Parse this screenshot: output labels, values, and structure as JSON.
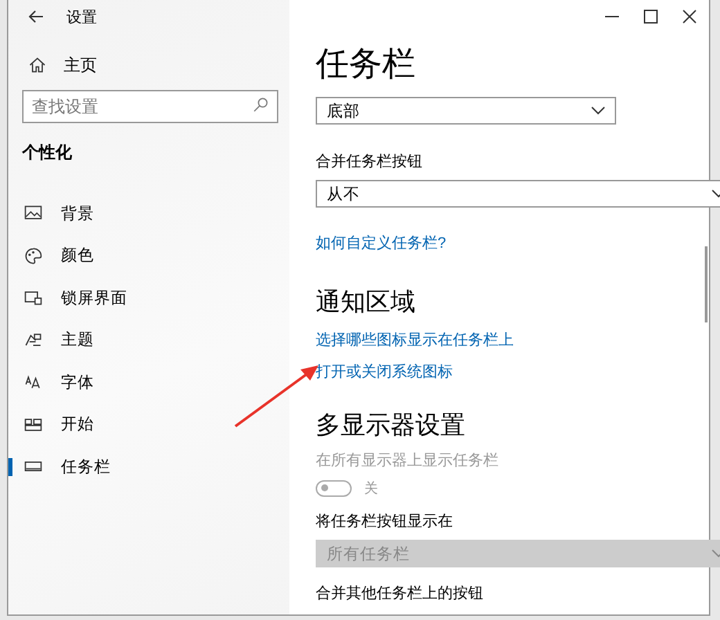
{
  "window": {
    "title": "设置"
  },
  "sidebar": {
    "home": "主页",
    "search": {
      "placeholder": "查找设置"
    },
    "section": "个性化",
    "items": [
      {
        "label": "背景",
        "selected": false
      },
      {
        "label": "颜色",
        "selected": false
      },
      {
        "label": "锁屏界面",
        "selected": false
      },
      {
        "label": "主题",
        "selected": false
      },
      {
        "label": "字体",
        "selected": false
      },
      {
        "label": "开始",
        "selected": false
      },
      {
        "label": "任务栏",
        "selected": true
      }
    ]
  },
  "content": {
    "title": "任务栏",
    "rows": [
      {
        "kind": "dropdown",
        "value": "底部",
        "disabled": false
      },
      {
        "kind": "dropdown",
        "label": "合并任务栏按钮",
        "value": "从不",
        "disabled": false
      },
      {
        "kind": "link",
        "text": "如何自定义任务栏?"
      },
      {
        "kind": "heading",
        "text": "通知区域"
      },
      {
        "kind": "link",
        "text": "选择哪些图标显示在任务栏上"
      },
      {
        "kind": "link",
        "text": "打开或关闭系统图标"
      },
      {
        "kind": "heading",
        "text": "多显示器设置"
      },
      {
        "kind": "toggle",
        "label": "在所有显示器上显示任务栏",
        "state_text": "关",
        "on": false,
        "disabled": true
      },
      {
        "kind": "dropdown",
        "label": "将任务栏按钮显示在",
        "value": "所有任务栏",
        "disabled": true
      },
      {
        "kind": "label",
        "text": "合并其他任务栏上的按钮"
      }
    ]
  }
}
